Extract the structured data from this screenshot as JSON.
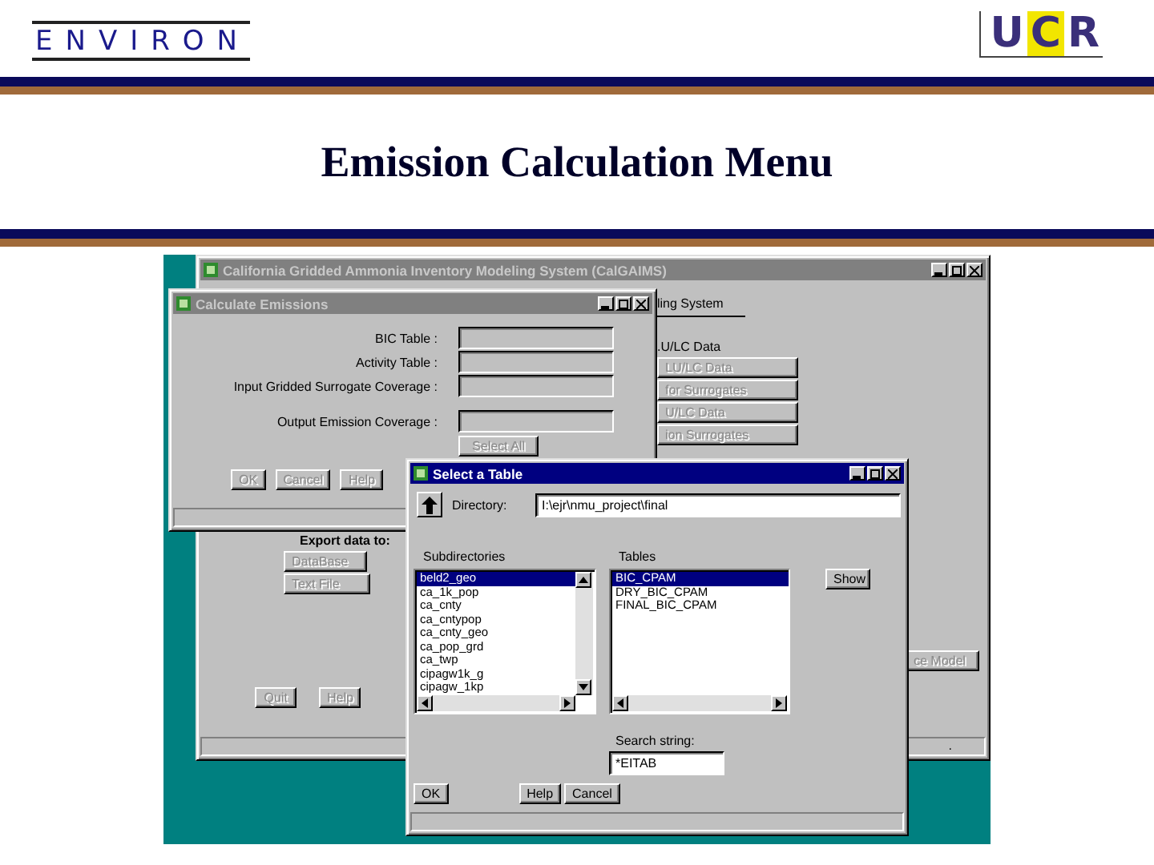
{
  "header": {
    "left_logo": "ENVIRON",
    "right_logo": [
      "U",
      "C",
      "R"
    ]
  },
  "title": "Emission Calculation Menu",
  "main_window": {
    "title": "California Gridded Ammonia Inventory Modeling System (CalGAIMS)",
    "active": false,
    "heading": "ling System",
    "section_label": ".U/LC Data",
    "buttons": [
      {
        "label": "LU/LC Data",
        "disabled": true
      },
      {
        "label": "for Surrogates",
        "disabled": true
      },
      {
        "label": "U/LC Data",
        "disabled": true
      },
      {
        "label": "ion Surrogates",
        "disabled": true
      }
    ],
    "export_label": "Export data to:",
    "export_buttons": [
      {
        "label": "DataBase",
        "disabled": true
      },
      {
        "label": "Text File",
        "disabled": true
      }
    ],
    "right_button": {
      "label": "ce Model",
      "disabled": true
    },
    "footer_buttons": [
      {
        "label": "Quit",
        "disabled": true
      },
      {
        "label": "Help",
        "disabled": true
      }
    ],
    "status": "."
  },
  "calculate_dialog": {
    "title": "Calculate Emissions",
    "active": false,
    "fields": [
      {
        "label": "BIC Table :"
      },
      {
        "label": "Activity Table :"
      },
      {
        "label": "Input Gridded Surrogate Coverage :"
      },
      {
        "label": "Output Emission Coverage :"
      }
    ],
    "select_all": {
      "label": "Select All",
      "disabled": true
    },
    "buttons": [
      {
        "label": "OK",
        "disabled": true
      },
      {
        "label": "Cancel",
        "disabled": true
      },
      {
        "label": "Help",
        "disabled": true
      }
    ]
  },
  "select_dialog": {
    "title": "Select a Table",
    "active": true,
    "directory_label": "Directory:",
    "directory": "I:\\ejr\\nmu_project\\final",
    "subdirectories_label": "Subdirectories",
    "subdirectories": [
      {
        "name": "beld2_geo",
        "selected": true
      },
      {
        "name": "ca_1k_pop",
        "selected": false
      },
      {
        "name": "ca_cnty",
        "selected": false
      },
      {
        "name": "ca_cntypop",
        "selected": false
      },
      {
        "name": "ca_cnty_geo",
        "selected": false
      },
      {
        "name": "ca_pop_grd",
        "selected": false
      },
      {
        "name": "ca_twp",
        "selected": false
      },
      {
        "name": "cipagw1k_g",
        "selected": false
      },
      {
        "name": "cipagw_1kp",
        "selected": false
      }
    ],
    "tables_label": "Tables",
    "tables": [
      {
        "name": "BIC_CPAM",
        "selected": true
      },
      {
        "name": "DRY_BIC_CPAM",
        "selected": false
      },
      {
        "name": "FINAL_BIC_CPAM",
        "selected": false
      }
    ],
    "show_button": {
      "label": "Show",
      "disabled": false
    },
    "search_label": "Search string:",
    "search": "*EITAB",
    "buttons": [
      {
        "label": "OK",
        "disabled": false
      },
      {
        "label": "Help",
        "disabled": false
      },
      {
        "label": "Cancel",
        "disabled": false
      }
    ]
  }
}
